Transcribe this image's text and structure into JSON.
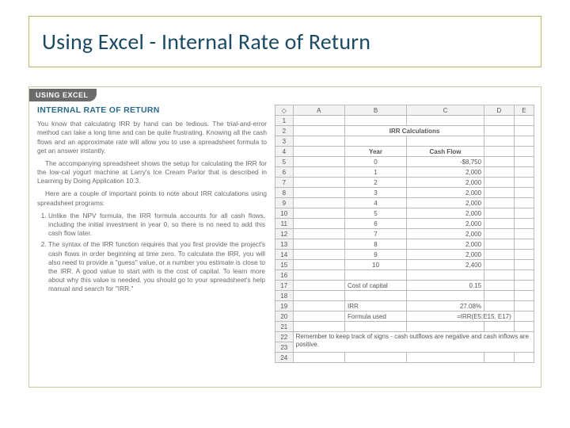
{
  "title": "Using Excel - Internal Rate of Return",
  "tab": "USING EXCEL",
  "section_heading": "INTERNAL RATE OF RETURN",
  "para1": "You know that calculating IRR by hand can be tedious. The trial-and-error method can take a long time and can be quite frustrating. Knowing all the cash flows and an approximate rate will allow you to use a spreadsheet formula to get an answer instantly.",
  "para2": "The accompanying spreadsheet shows the setup for calculating the IRR for the low-cal yogurt machine at Larry's Ice Cream Parlor that is described in Learning by Doing Application 10.3.",
  "para3": "Here are a couple of important points to note about IRR calculations using spreadsheet programs:",
  "li1": "Unlike the NPV formula, the IRR formula accounts for all cash flows, including the initial investment in year 0, so there is no need to add this cash flow later.",
  "li2": "The syntax of the IRR function requires that you first provide the project's cash flows in order beginning at time zero. To calculate the IRR, you will also need to provide a \"guess\" value, or a number you estimate is close to the IRR. A good value to start with is the cost of capital. To learn more about why this value is needed, you should go to your spreadsheet's help manual and search for \"IRR.\"",
  "sheet": {
    "cols": [
      "A",
      "B",
      "C",
      "D",
      "E"
    ],
    "title_cell": "IRR Calculations",
    "year_hdr": "Year",
    "cash_hdr": "Cash Flow",
    "rows": [
      {
        "y": "0",
        "cf": "-$8,750"
      },
      {
        "y": "1",
        "cf": "2,000"
      },
      {
        "y": "2",
        "cf": "2,000"
      },
      {
        "y": "3",
        "cf": "2,000"
      },
      {
        "y": "4",
        "cf": "2,000"
      },
      {
        "y": "5",
        "cf": "2,000"
      },
      {
        "y": "6",
        "cf": "2,000"
      },
      {
        "y": "7",
        "cf": "2,000"
      },
      {
        "y": "8",
        "cf": "2,000"
      },
      {
        "y": "9",
        "cf": "2,000"
      },
      {
        "y": "10",
        "cf": "2,400"
      }
    ],
    "coc_label": "Cost of capital",
    "coc_value": "0.15",
    "irr_label": "IRR",
    "irr_value": "27.08%",
    "formula_label": "Formula used",
    "formula_value": "=IRR(E5:E15, E17)",
    "footnote": "Remember to keep track of signs - cash outflows are negative and cash inflows are positive."
  }
}
